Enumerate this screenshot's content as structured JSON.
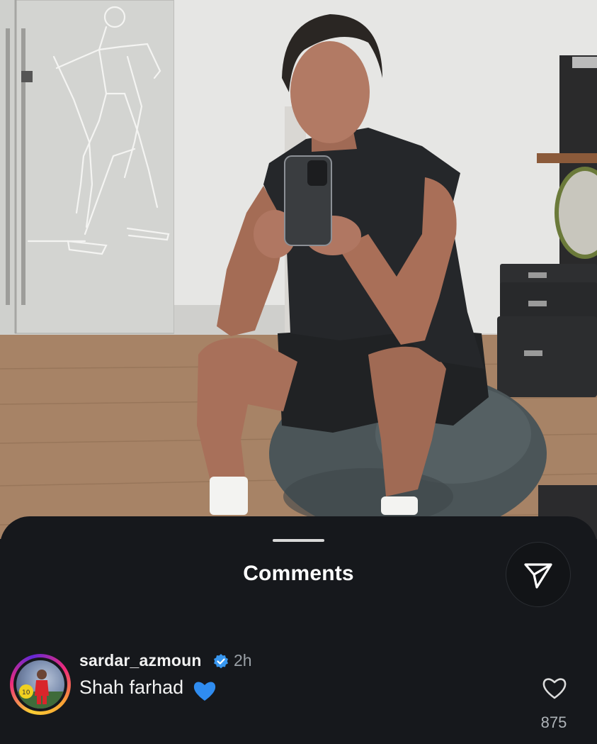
{
  "photo": {
    "subject": "mirror-selfie-gym"
  },
  "sheet": {
    "title": "Comments",
    "share_icon": "send-icon"
  },
  "comment": {
    "username": "sardar_azmoun",
    "verified": true,
    "time": "2h",
    "text": "Shah farhad",
    "emoji": "blue-heart",
    "likes": "875",
    "like_icon": "heart-outline-icon"
  },
  "colors": {
    "sheet_bg": "#16181c",
    "text": "#f2f2f2",
    "muted": "#9aa0a6",
    "verified_blue": "#3897f0",
    "emoji_blue": "#2f8cf0"
  }
}
